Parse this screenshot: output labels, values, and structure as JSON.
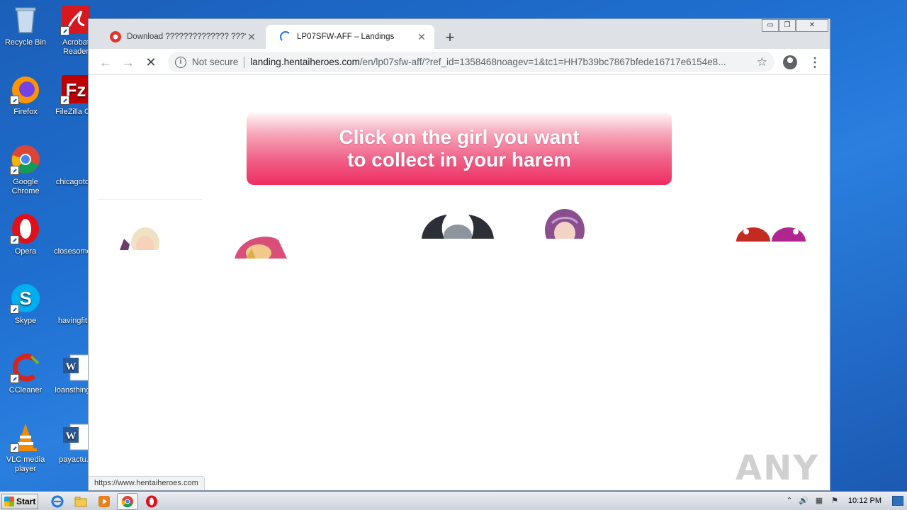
{
  "desktop": {
    "icons_left": [
      {
        "name": "recycle-bin",
        "label": "Recycle Bin"
      },
      {
        "name": "firefox",
        "label": "Firefox"
      },
      {
        "name": "google-chrome",
        "label": "Google Chrome"
      },
      {
        "name": "opera",
        "label": "Opera"
      },
      {
        "name": "skype",
        "label": "Skype"
      },
      {
        "name": "ccleaner",
        "label": "CCleaner"
      },
      {
        "name": "vlc",
        "label": "VLC media player"
      }
    ],
    "icons_right": [
      {
        "name": "acrobat",
        "label": "Acrobat Reader"
      },
      {
        "name": "filezilla",
        "label": "FileZilla C..."
      },
      {
        "name": "chicagoto",
        "label": "chicagoto..."
      },
      {
        "name": "closesome",
        "label": "closesome..."
      },
      {
        "name": "havingfit",
        "label": "havingfit..."
      },
      {
        "name": "loansthing",
        "label": "loansthing..."
      },
      {
        "name": "payactu",
        "label": "payactu..."
      }
    ]
  },
  "browser": {
    "tabs": [
      {
        "title": "Download ?????????????? ??????? ???",
        "close": "✕",
        "active": false
      },
      {
        "title": "LP07SFW-AFF – Landings",
        "close": "✕",
        "active": true
      }
    ],
    "new_tab": "+",
    "window_controls": {
      "minimize": "▭",
      "restore": "❐",
      "close": "✕"
    },
    "address": {
      "security_text": "Not secure",
      "domain": "landing.hentaiheroes.com",
      "path": "/en/lp07sfw-aff/?ref_id=1358468noagev=1&tc1=HH7b39bc7867bfede16717e6154e8..."
    },
    "status_url": "https://www.hentaiheroes.com"
  },
  "page": {
    "banner_line1": "Click on the girl you want",
    "banner_line2": "to collect in your harem",
    "banner_colors": {
      "top": "#fff6f8",
      "bottom": "#ee2d62"
    }
  },
  "watermark": "ANY RUN",
  "taskbar": {
    "start_label": "Start",
    "clock": "10:12 PM"
  }
}
